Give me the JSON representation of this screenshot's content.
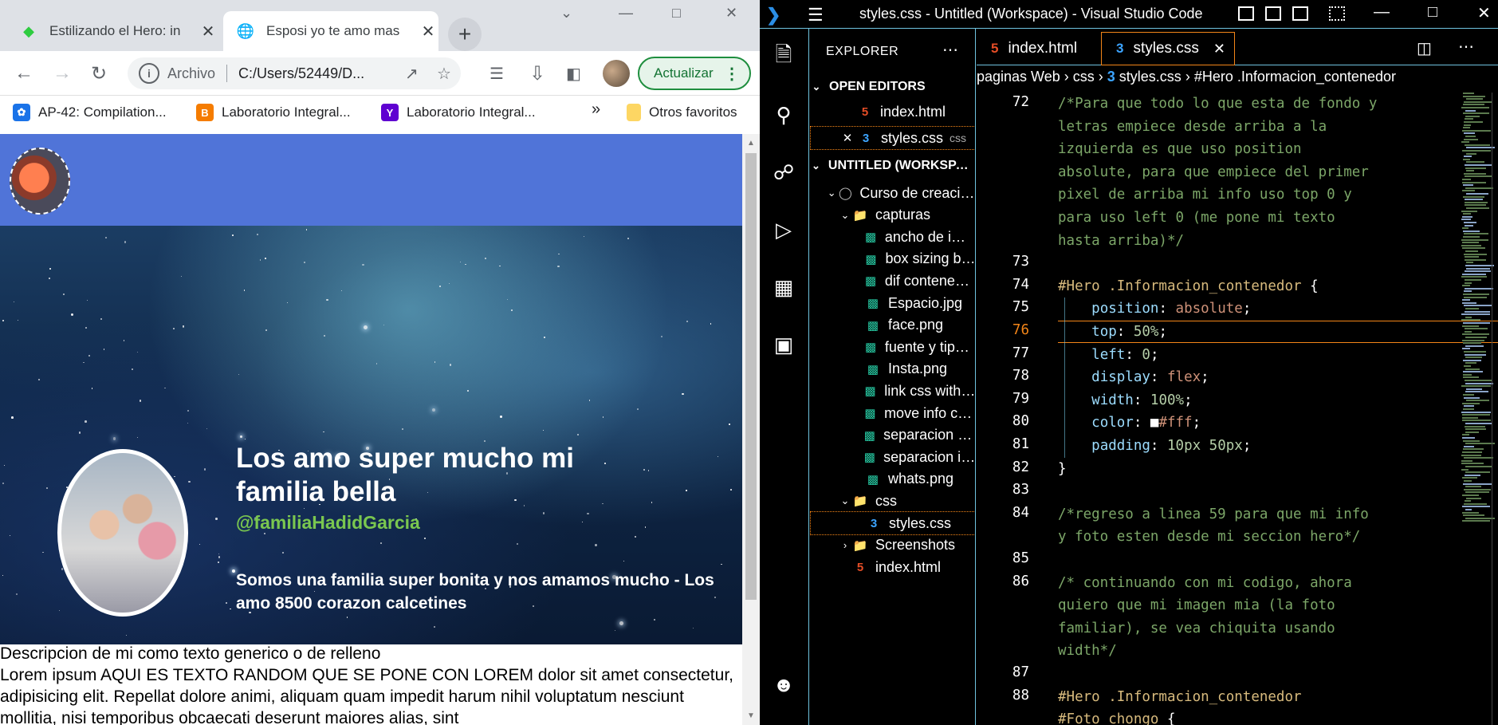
{
  "browser": {
    "tabs": [
      {
        "title": "Estilizando el Hero: in",
        "icon": "codepen-style-icon"
      },
      {
        "title": "Esposi yo te amo mas",
        "icon": "globe-icon"
      }
    ],
    "omnibox": {
      "protocol": "Archivo",
      "url": "C:/Users/52449/D..."
    },
    "update_label": "Actualizar",
    "bookmarks": [
      {
        "label": "AP-42: Compilation...",
        "color": "#1a73e8"
      },
      {
        "label": "Laboratorio Integral...",
        "color": "#f57c00"
      },
      {
        "label": "Laboratorio Integral...",
        "color": "#5f01d1"
      }
    ],
    "bookmarks_more": "»",
    "bookmarks_other": "Otros favoritos"
  },
  "page": {
    "hero_title": "Los amo super mucho mi familia bella",
    "hero_handle": "@familiaHadidGarcia",
    "hero_desc": "Somos una familia super bonita y nos amamos mucho - Los amo 8500 corazon calcetines",
    "desc_heading": "Descripcion de mi como texto generico o de relleno",
    "desc_body": "Lorem ipsum AQUI ES TEXTO RANDOM QUE SE PONE CON LOREM dolor sit amet consectetur, adipisicing elit. Repellat dolore animi, aliquam quam impedit harum nihil voluptatum nesciunt mollitia, nisi temporibus obcaecati deserunt maiores alias, sint"
  },
  "vscode": {
    "window_title": "styles.css - Untitled (Workspace) - Visual Studio Code",
    "explorer_title": "EXPLORER",
    "open_editors": "OPEN EDITORS",
    "open_files": [
      {
        "name": "index.html",
        "type": "html",
        "hint": ""
      },
      {
        "name": "styles.css",
        "type": "css",
        "hint": "css"
      }
    ],
    "workspace": "UNTITLED (WORKSPACE)",
    "tree": [
      {
        "name": "Curso de creacion...",
        "type": "root",
        "indent": 0
      },
      {
        "name": "capturas",
        "type": "folder",
        "indent": 1
      },
      {
        "name": "ancho de img ...",
        "type": "img",
        "indent": 2
      },
      {
        "name": "box sizing bor...",
        "type": "img",
        "indent": 2
      },
      {
        "name": "dif contenedor...",
        "type": "img",
        "indent": 2
      },
      {
        "name": "Espacio.jpg",
        "type": "img",
        "indent": 2
      },
      {
        "name": "face.png",
        "type": "img",
        "indent": 2
      },
      {
        "name": "fuente y tipo d...",
        "type": "img",
        "indent": 2
      },
      {
        "name": "Insta.png",
        "type": "img",
        "indent": 2
      },
      {
        "name": "link css with ht...",
        "type": "img",
        "indent": 2
      },
      {
        "name": "move info cont...",
        "type": "img",
        "indent": 2
      },
      {
        "name": "separacion del ...",
        "type": "img",
        "indent": 2
      },
      {
        "name": "separacion img...",
        "type": "img",
        "indent": 2
      },
      {
        "name": "whats.png",
        "type": "img",
        "indent": 2
      },
      {
        "name": "css",
        "type": "cssfolder",
        "indent": 1
      },
      {
        "name": "styles.css",
        "type": "css",
        "indent": 2
      },
      {
        "name": "Screenshots",
        "type": "imgfolder",
        "indent": 1
      },
      {
        "name": "index.html",
        "type": "html",
        "indent": 1
      }
    ],
    "editor_tabs": [
      {
        "name": "index.html",
        "type": "html"
      },
      {
        "name": "styles.css",
        "type": "css"
      }
    ],
    "breadcrumb": [
      "paginas Web",
      "css",
      "styles.css",
      "#Hero .Informacion_contenedor"
    ],
    "code": [
      {
        "n": "72",
        "parts": [
          [
            "cm",
            "/*Para que todo lo que esta de fondo y"
          ]
        ]
      },
      {
        "n": "",
        "parts": [
          [
            "cm",
            "letras empiece desde arriba a la"
          ]
        ]
      },
      {
        "n": "",
        "parts": [
          [
            "cm",
            "izquierda es que uso position"
          ]
        ]
      },
      {
        "n": "",
        "parts": [
          [
            "cm",
            "absolute, para que empiece del primer"
          ]
        ]
      },
      {
        "n": "",
        "parts": [
          [
            "cm",
            "pixel de arriba mi info uso top 0 y"
          ]
        ]
      },
      {
        "n": "",
        "parts": [
          [
            "cm",
            "para uso left 0 (me pone mi texto"
          ]
        ]
      },
      {
        "n": "",
        "parts": [
          [
            "cm",
            "hasta arriba)*/"
          ]
        ]
      },
      {
        "n": "73",
        "parts": []
      },
      {
        "n": "74",
        "parts": [
          [
            "sel-c",
            "#Hero .Informacion_contenedor"
          ],
          [
            "",
            " {"
          ]
        ]
      },
      {
        "n": "75",
        "parts": [
          [
            "",
            "    "
          ],
          [
            "pr",
            "position"
          ],
          [
            "",
            ": "
          ],
          [
            "vl",
            "absolute"
          ],
          [
            "",
            ";"
          ]
        ]
      },
      {
        "n": "76",
        "parts": [
          [
            "",
            "    "
          ],
          [
            "pr",
            "top"
          ],
          [
            "",
            ": "
          ],
          [
            "nm",
            "50%"
          ],
          [
            "",
            ";"
          ]
        ]
      },
      {
        "n": "77",
        "parts": [
          [
            "",
            "    "
          ],
          [
            "pr",
            "left"
          ],
          [
            "",
            ": "
          ],
          [
            "nm",
            "0"
          ],
          [
            "",
            ";"
          ]
        ]
      },
      {
        "n": "78",
        "parts": [
          [
            "",
            "    "
          ],
          [
            "pr",
            "display"
          ],
          [
            "",
            ": "
          ],
          [
            "vl",
            "flex"
          ],
          [
            "",
            ";"
          ]
        ]
      },
      {
        "n": "79",
        "parts": [
          [
            "",
            "    "
          ],
          [
            "pr",
            "width"
          ],
          [
            "",
            ": "
          ],
          [
            "nm",
            "100%"
          ],
          [
            "",
            ";"
          ]
        ]
      },
      {
        "n": "80",
        "parts": [
          [
            "",
            "    "
          ],
          [
            "pr",
            "color"
          ],
          [
            "",
            ": ■"
          ],
          [
            "vl",
            "#fff"
          ],
          [
            "",
            ";"
          ]
        ]
      },
      {
        "n": "81",
        "parts": [
          [
            "",
            "    "
          ],
          [
            "pr",
            "padding"
          ],
          [
            "",
            ": "
          ],
          [
            "nm",
            "10px 50px"
          ],
          [
            "",
            ";"
          ]
        ]
      },
      {
        "n": "82",
        "parts": [
          [
            "",
            "}"
          ]
        ]
      },
      {
        "n": "83",
        "parts": []
      },
      {
        "n": "84",
        "parts": [
          [
            "cm",
            "/*regreso a linea 59 para que mi info"
          ]
        ]
      },
      {
        "n": "",
        "parts": [
          [
            "cm",
            "y foto esten desde mi seccion hero*/"
          ]
        ]
      },
      {
        "n": "85",
        "parts": []
      },
      {
        "n": "86",
        "parts": [
          [
            "cm",
            "/* continuando con mi codigo, ahora"
          ]
        ]
      },
      {
        "n": "",
        "parts": [
          [
            "cm",
            "quiero que mi imagen mia (la foto"
          ]
        ]
      },
      {
        "n": "",
        "parts": [
          [
            "cm",
            "familiar), se vea chiquita usando"
          ]
        ]
      },
      {
        "n": "",
        "parts": [
          [
            "cm",
            "width*/"
          ]
        ]
      },
      {
        "n": "87",
        "parts": []
      },
      {
        "n": "88",
        "parts": [
          [
            "sel-c",
            "#Hero .Informacion_contenedor"
          ]
        ]
      },
      {
        "n": "",
        "parts": [
          [
            "sel-c",
            "#Foto_chongo"
          ],
          [
            "",
            " {"
          ]
        ]
      }
    ],
    "current_line": "76"
  }
}
